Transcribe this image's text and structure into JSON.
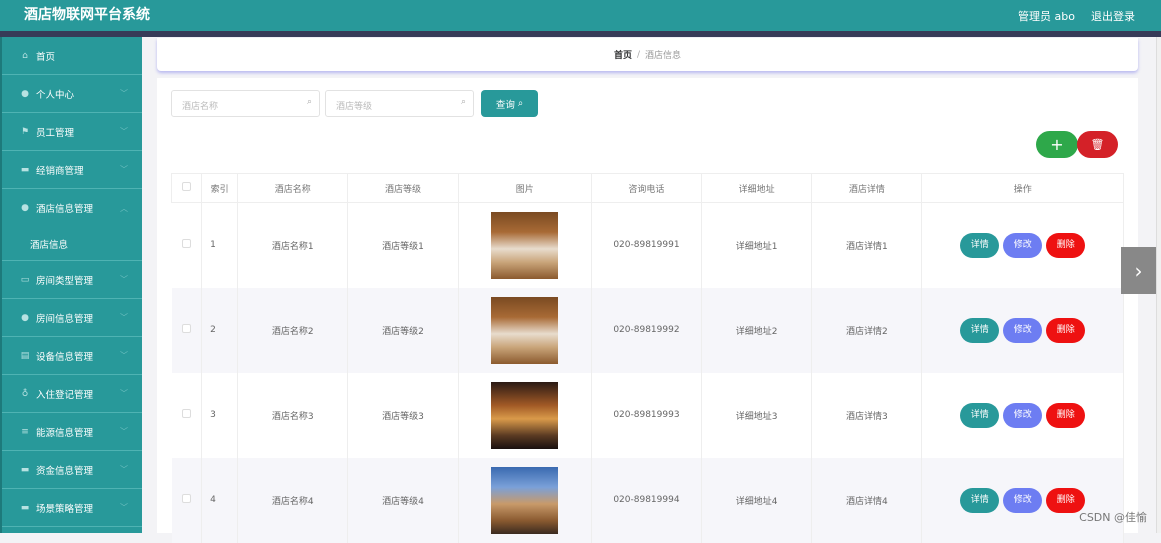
{
  "header": {
    "title": "酒店物联网平台系统",
    "user": "管理员 abo",
    "logout": "退出登录"
  },
  "sidebar": {
    "items": [
      {
        "label": "首页",
        "icon": "home-icon",
        "glyph": "⌂"
      },
      {
        "label": "个人中心",
        "icon": "user-icon",
        "glyph": "●"
      },
      {
        "label": "员工管理",
        "icon": "flag-icon",
        "glyph": "⚑"
      },
      {
        "label": "经销商管理",
        "icon": "monitor-icon",
        "glyph": "▬"
      },
      {
        "label": "酒店信息管理",
        "icon": "user-icon",
        "glyph": "●"
      },
      {
        "label": "房间类型管理",
        "icon": "message-icon",
        "glyph": "▭"
      },
      {
        "label": "房间信息管理",
        "icon": "location-icon",
        "glyph": "●"
      },
      {
        "label": "设备信息管理",
        "icon": "clipboard-icon",
        "glyph": "▤"
      },
      {
        "label": "入住登记管理",
        "icon": "microphone-icon",
        "glyph": "♁"
      },
      {
        "label": "能源信息管理",
        "icon": "list-icon",
        "glyph": "≡"
      },
      {
        "label": "资金信息管理",
        "icon": "wallet-icon",
        "glyph": "▬"
      },
      {
        "label": "场景策略管理",
        "icon": "briefcase-icon",
        "glyph": "▬"
      }
    ],
    "sub": "酒店信息"
  },
  "breadcrumb": {
    "home": "首页",
    "sep": "/",
    "current": "酒店信息"
  },
  "search": {
    "name_placeholder": "酒店名称",
    "level_placeholder": "酒店等级",
    "query": "查询"
  },
  "table": {
    "headers": [
      "索引",
      "酒店名称",
      "酒店等级",
      "图片",
      "咨询电话",
      "详细地址",
      "酒店详情",
      "操作"
    ],
    "rows": [
      {
        "idx": "1",
        "name": "酒店名称1",
        "level": "酒店等级1",
        "phone": "020-89819991",
        "addr": "详细地址1",
        "detail": "酒店详情1"
      },
      {
        "idx": "2",
        "name": "酒店名称2",
        "level": "酒店等级2",
        "phone": "020-89819992",
        "addr": "详细地址2",
        "detail": "酒店详情2"
      },
      {
        "idx": "3",
        "name": "酒店名称3",
        "level": "酒店等级3",
        "phone": "020-89819993",
        "addr": "详细地址3",
        "detail": "酒店详情3"
      },
      {
        "idx": "4",
        "name": "酒店名称4",
        "level": "酒店等级4",
        "phone": "020-89819994",
        "addr": "详细地址4",
        "detail": "酒店详情4"
      }
    ],
    "actions": {
      "detail": "详情",
      "edit": "修改",
      "delete": "删除"
    }
  },
  "colors": {
    "teal": "#28999a",
    "edit": "#6d7df2",
    "delete": "#ee1111",
    "add": "#2ea84a"
  },
  "watermark": "CSDN @佳愉"
}
